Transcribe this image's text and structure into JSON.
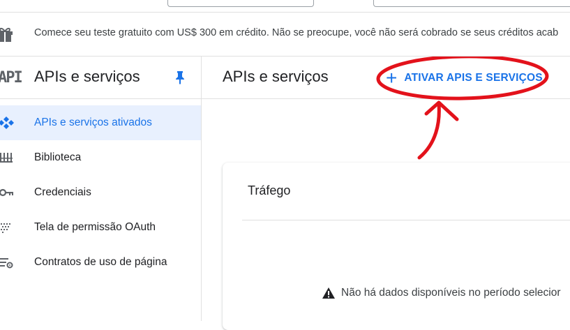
{
  "banner": {
    "icon": "gift-icon",
    "text": "Comece seu teste gratuito com US$ 300 em crédito. Não se preocupe, você não será cobrado se seus créditos acab"
  },
  "sidebar": {
    "logo": "API",
    "title": "APIs e serviços",
    "pin_icon": "pin-icon",
    "items": [
      {
        "label": "APIs e serviços ativados",
        "icon": "apis-services-icon",
        "active": true
      },
      {
        "label": "Biblioteca",
        "icon": "library-icon",
        "active": false
      },
      {
        "label": "Credenciais",
        "icon": "key-icon",
        "active": false
      },
      {
        "label": "Tela de permissão OAuth",
        "icon": "oauth-consent-icon",
        "active": false
      },
      {
        "label": "Contratos de uso de página",
        "icon": "page-usage-agreements-icon",
        "active": false
      }
    ]
  },
  "main": {
    "title": "APIs e serviços",
    "enable_button": "ATIVAR APIS E SERVIÇOS",
    "card": {
      "title": "Tráfego",
      "empty_message": "Não há dados disponíveis no período selecior"
    }
  },
  "colors": {
    "accent": "#1a73e8",
    "active_bg": "#e8f0fe",
    "annotation": "#e3121b"
  }
}
